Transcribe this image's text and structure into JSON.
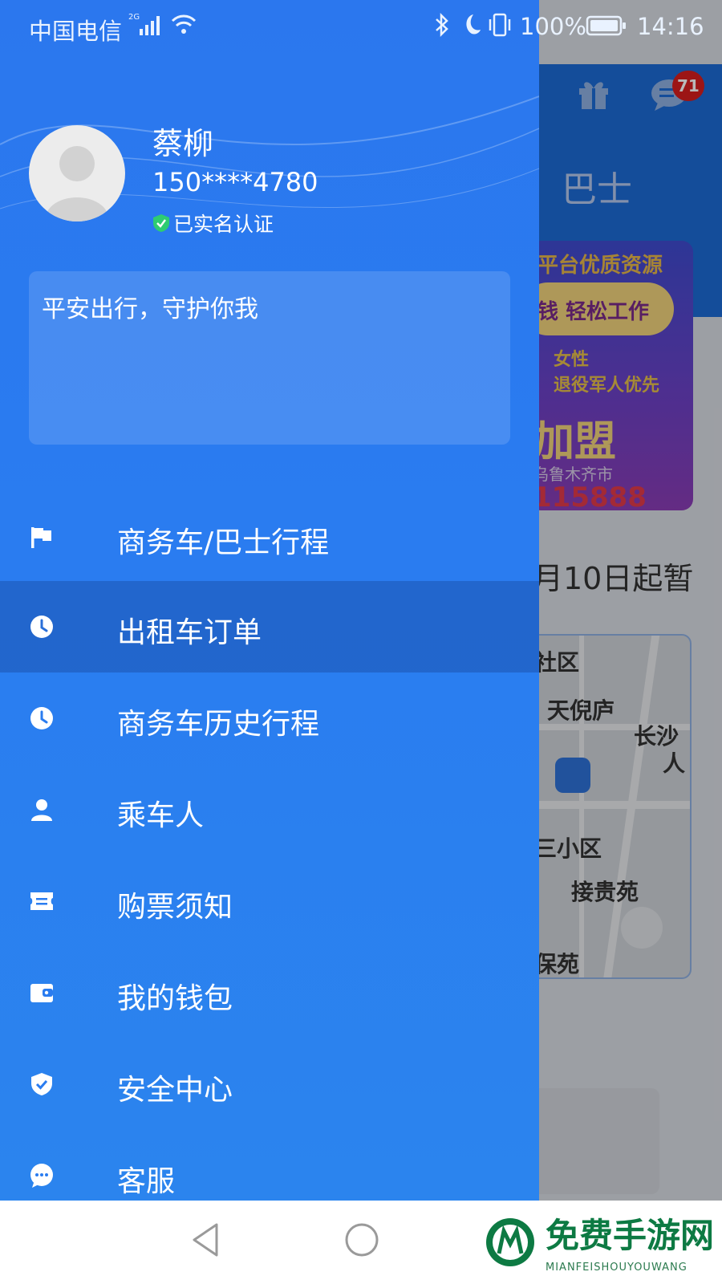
{
  "status_bar": {
    "carrier": "中国电信",
    "network": "2G",
    "battery": "100%",
    "time": "14:16"
  },
  "background_app": {
    "badge_count": "71",
    "tab_label": "巴士",
    "banner": {
      "line1": "平台优质资源",
      "line2": "钱 轻松工作",
      "line3": "女性",
      "line4": "退役军人优先",
      "line5": "加盟",
      "line6": "乌鲁木齐市",
      "line7": "115888"
    },
    "notice": "月10日起暂",
    "map_labels": [
      "社区",
      "天倪庐",
      "长沙",
      "人",
      "三小区",
      "接贵苑",
      "保苑"
    ]
  },
  "drawer": {
    "user_name": "蔡柳",
    "phone": "150****4780",
    "verified_text": "已实名认证",
    "motto": "平安出行，守护你我",
    "menu": [
      {
        "label": "商务车/巴士行程",
        "icon": "flag-icon"
      },
      {
        "label": "出租车订单",
        "icon": "clock-icon"
      },
      {
        "label": "商务车历史行程",
        "icon": "clock-icon"
      },
      {
        "label": "乘车人",
        "icon": "person-icon"
      },
      {
        "label": "购票须知",
        "icon": "ticket-icon"
      },
      {
        "label": "我的钱包",
        "icon": "wallet-icon"
      },
      {
        "label": "安全中心",
        "icon": "shield-icon"
      },
      {
        "label": "客服",
        "icon": "chat-icon"
      }
    ],
    "active_index": 1
  },
  "watermark": {
    "title": "免费手游网",
    "subtitle": "MIANFEISHOUYOUWANG"
  },
  "colors": {
    "drawer_blue": "#2a7cf0",
    "verified_green": "#2ecc71",
    "badge_red": "#d81e1e",
    "watermark_green": "#0d7a43"
  }
}
